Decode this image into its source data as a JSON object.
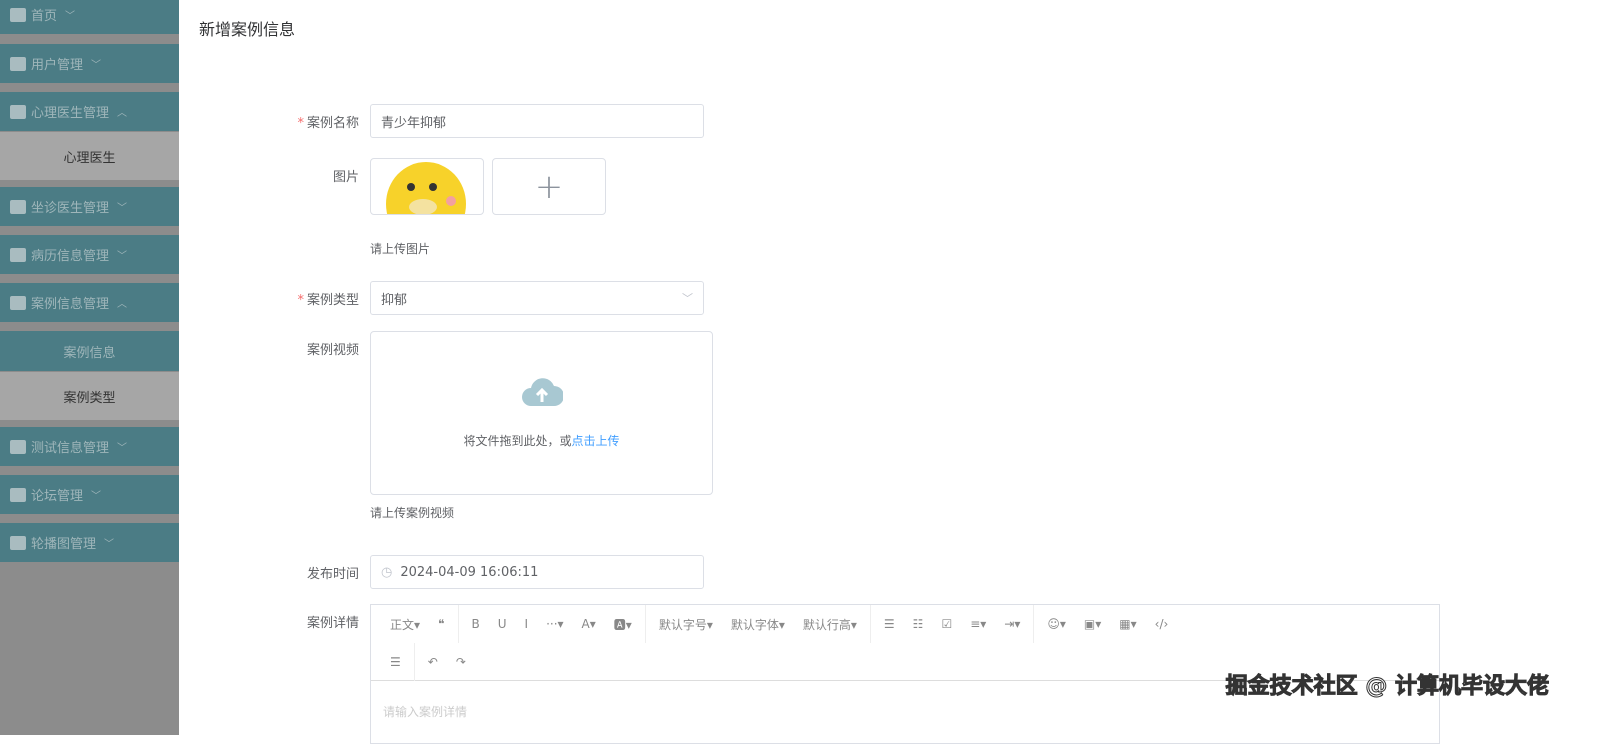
{
  "sidebar": {
    "menus": [
      "首页",
      "用户管理",
      "心理医生管理",
      "坐诊医生管理",
      "病历信息管理",
      "案例信息管理",
      "测试信息管理",
      "论坛管理",
      "轮播图管理"
    ],
    "subs": [
      "心理医生",
      "案例信息",
      "案例类型"
    ]
  },
  "page": {
    "title": "新增案例信息"
  },
  "form": {
    "name_label": "案例名称",
    "name_value": "青少年抑郁",
    "image_label": "图片",
    "image_hint": "请上传图片",
    "type_label": "案例类型",
    "type_value": "抑郁",
    "video_label": "案例视频",
    "drag_text": "将文件拖到此处，或",
    "drag_link": "点击上传",
    "video_hint": "请上传案例视频",
    "time_label": "发布时间",
    "time_value": "2024-04-09 16:06:11",
    "detail_label": "案例详情",
    "detail_placeholder": "请输入案例详情"
  },
  "toolbar": {
    "items": [
      "正文▾",
      "❝",
      "B",
      "U",
      "I",
      "···▾",
      "A▾",
      "🅰▾",
      "默认字号▾",
      "默认字体▾",
      "默认行高▾",
      "☰",
      "☷",
      "☑",
      "≡▾",
      "⇥▾",
      "☺▾",
      "▣▾",
      "▦▾",
      "‹/›"
    ],
    "row2": [
      "☰",
      "↶",
      "↷"
    ]
  },
  "watermark": "掘金技术社区 @ 计算机毕设大佬"
}
